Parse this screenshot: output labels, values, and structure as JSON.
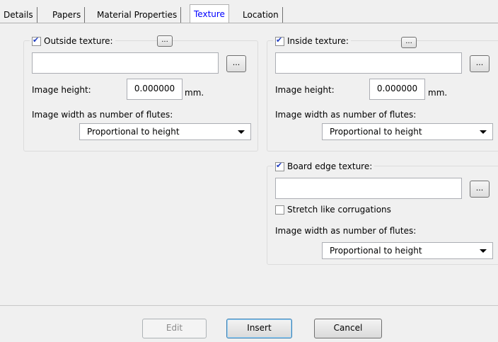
{
  "tabs": [
    {
      "label": "Details"
    },
    {
      "label": "Papers"
    },
    {
      "label": "Material Properties"
    },
    {
      "label": "Texture"
    },
    {
      "label": "Location"
    }
  ],
  "outside": {
    "title": "Outside texture:",
    "checked": true,
    "browse_label": "...",
    "path_value": "",
    "height_label": "Image height:",
    "height_value": "0.000000",
    "unit": "mm.",
    "width_label": "Image width as number of flutes:",
    "width_option": "Proportional to height"
  },
  "inside": {
    "title": "Inside texture:",
    "checked": true,
    "browse_label": "...",
    "path_value": "",
    "height_label": "Image height:",
    "height_value": "0.000000",
    "unit": "mm.",
    "width_label": "Image width as number of flutes:",
    "width_option": "Proportional to height"
  },
  "edge": {
    "title": "Board edge texture:",
    "checked": true,
    "browse_label": "...",
    "path_value": "",
    "stretch_label": "Stretch like corrugations",
    "stretch_checked": false,
    "width_label": "Image width as number of flutes:",
    "width_option": "Proportional to height"
  },
  "footer": {
    "edit_label": "Edit",
    "insert_label": "Insert",
    "cancel_label": "Cancel"
  }
}
